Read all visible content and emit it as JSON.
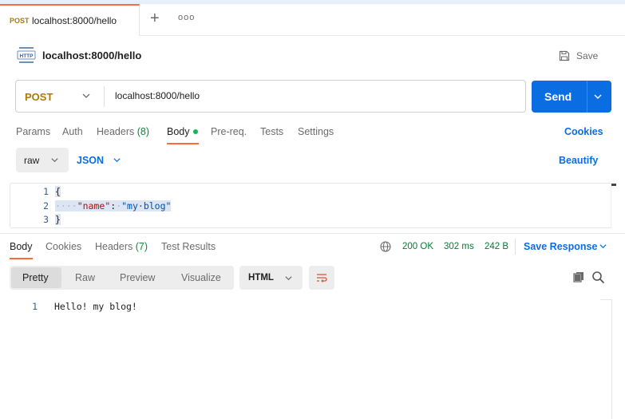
{
  "tabbar": {
    "active_tab": {
      "method": "POST",
      "title": "localhost:8000/hello"
    },
    "add_icon": "plus-icon",
    "more_icon": "ellipsis-icon",
    "more_label": "ooo"
  },
  "request": {
    "title": "localhost:8000/hello",
    "icon": "http-icon",
    "save_label": "Save",
    "method": "POST",
    "url": "localhost:8000/hello",
    "send_label": "Send"
  },
  "request_tabs": {
    "params": "Params",
    "auth": "Auth",
    "headers": "Headers",
    "headers_count": "(8)",
    "body": "Body",
    "prereq": "Pre-req.",
    "tests": "Tests",
    "settings": "Settings",
    "cookies": "Cookies"
  },
  "body_options": {
    "mode": "raw",
    "language": "JSON",
    "beautify": "Beautify"
  },
  "editor": {
    "lines": [
      {
        "num": "1",
        "text": "{"
      },
      {
        "num": "2",
        "ws": "····",
        "key": "\"name\"",
        "colon": ":",
        "sp": "·",
        "value": "\"my·blog\""
      },
      {
        "num": "3",
        "text": "}"
      }
    ]
  },
  "response_tabs": {
    "body": "Body",
    "cookies": "Cookies",
    "headers": "Headers",
    "headers_count": "(7)",
    "test_results": "Test Results"
  },
  "response_status": {
    "status": "200 OK",
    "time": "302 ms",
    "size": "242 B",
    "save_response": "Save Response"
  },
  "response_view": {
    "modes": [
      "Pretty",
      "Raw",
      "Preview",
      "Visualize"
    ],
    "active_mode": "Pretty",
    "format": "HTML"
  },
  "response_body": {
    "lines": [
      {
        "num": "1",
        "text": "Hello! my blog!"
      }
    ]
  },
  "colors": {
    "accent": "#ff6c37",
    "primary": "#0a6de1",
    "post_method": "#ad7a03",
    "status_ok": "#007f31"
  }
}
